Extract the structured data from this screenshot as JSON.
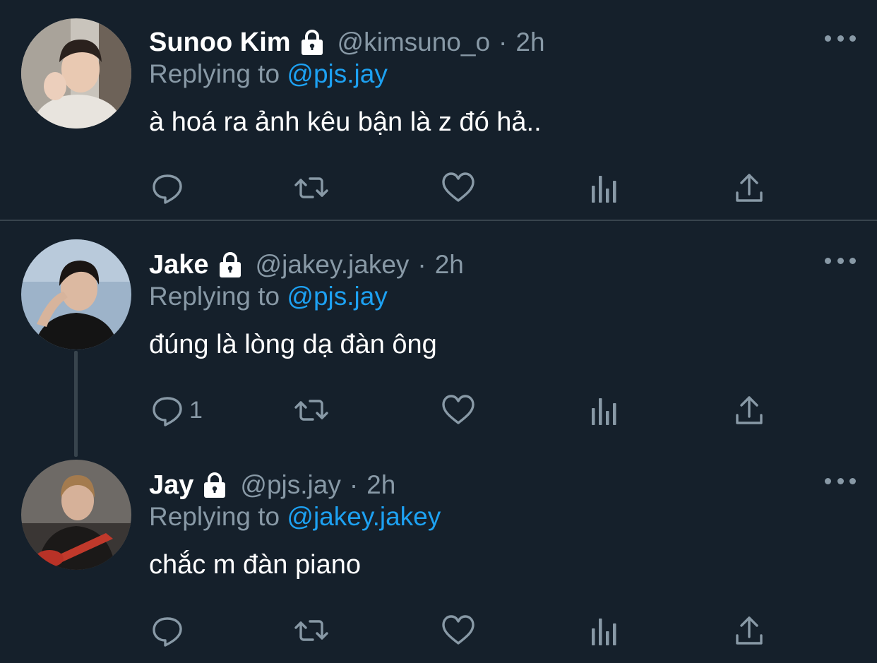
{
  "colors": {
    "background": "#15202b",
    "divider": "#38444d",
    "text_primary": "#ffffff",
    "text_secondary": "#8899a6",
    "mention": "#1da1f2"
  },
  "tweets": [
    {
      "display_name": "Sunoo Kim",
      "handle": "@kimsuno_o",
      "separator": "·",
      "time": "2h",
      "replying_prefix": "Replying to",
      "replying_to": "@pjs.jay",
      "text": "à hoá ra ảnh kêu bận là z đó hả..",
      "reply_count": "",
      "protected_icon": "lock-icon",
      "avatar": "avatar-photo"
    },
    {
      "display_name": "Jake",
      "handle": "@jakey.jakey",
      "separator": "·",
      "time": "2h",
      "replying_prefix": "Replying to",
      "replying_to": "@pjs.jay",
      "text": "đúng là lòng dạ đàn ông",
      "reply_count": "1",
      "protected_icon": "lock-icon",
      "avatar": "avatar-photo"
    },
    {
      "display_name": "Jay",
      "handle": "@pjs.jay",
      "separator": "·",
      "time": "2h",
      "replying_prefix": "Replying to",
      "replying_to": "@jakey.jakey",
      "text": "chắc m đàn piano",
      "reply_count": "",
      "protected_icon": "lock-icon",
      "avatar": "avatar-photo"
    }
  ],
  "action_icons": [
    "reply-icon",
    "retweet-icon",
    "like-icon",
    "analytics-icon",
    "share-icon"
  ]
}
